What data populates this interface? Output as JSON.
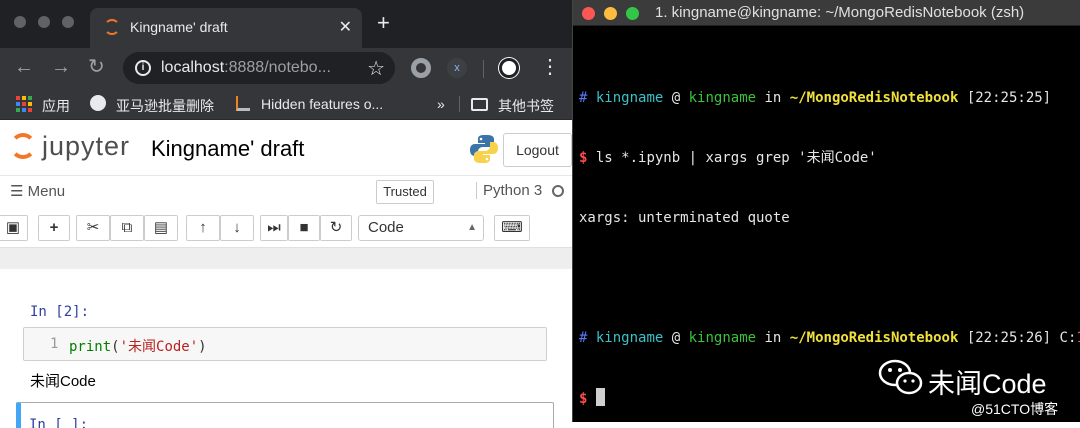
{
  "browser": {
    "tab_title": "Kingname' draft",
    "tab_close": "✕",
    "new_tab": "+",
    "url_host": "localhost",
    "url_rest": ":8888/notebo...",
    "bookmarks": [
      {
        "label": "应用"
      },
      {
        "label": "亚马逊批量删除"
      },
      {
        "label": "Hidden features o..."
      },
      {
        "label": "»"
      },
      {
        "label": "其他书签"
      }
    ]
  },
  "jupyter": {
    "logo_text": "jupyter",
    "notebook_title": "Kingname' draft",
    "logout_label": "Logout",
    "menu_label": "Menu",
    "trusted_label": "Trusted",
    "kernel_name": "Python 3",
    "cell_type": "Code",
    "cells": [
      {
        "prompt": "In [2]:",
        "line_number": "1",
        "code_fn": "print",
        "code_open": "(",
        "code_string": "'未闻Code'",
        "code_close": ")",
        "output": "未闻Code"
      },
      {
        "prompt": "In [ ]:"
      }
    ]
  },
  "terminal": {
    "window_title": "1. kingname@kingname: ~/MongoRedisNotebook (zsh)",
    "line1": {
      "hash": "#",
      "user": "kingname",
      "at": "@",
      "host": "kingname",
      "in": "in",
      "path": "~/MongoRedisNotebook",
      "time": "[22:25:25]"
    },
    "line2": {
      "prompt": "$",
      "command": "ls *.ipynb | xargs grep '未闻Code'"
    },
    "line3": "xargs: unterminated quote",
    "line5": {
      "hash": "#",
      "user": "kingname",
      "at": "@",
      "host": "kingname",
      "in": "in",
      "path": "~/MongoRedisNotebook",
      "time": "[22:25:26]",
      "exit_prefix": "C:",
      "exit_code": "1"
    },
    "line6": {
      "prompt": "$"
    }
  },
  "watermark": {
    "brand": "未闻Code",
    "site": "@51CTO博客"
  },
  "colors": {
    "jupyter_orange": "#f37726",
    "selected_cell_bar": "#42a5f5",
    "terminal_blue": "#5c79f5",
    "terminal_green": "#3cc13c",
    "terminal_yellow": "#f0e03c"
  }
}
